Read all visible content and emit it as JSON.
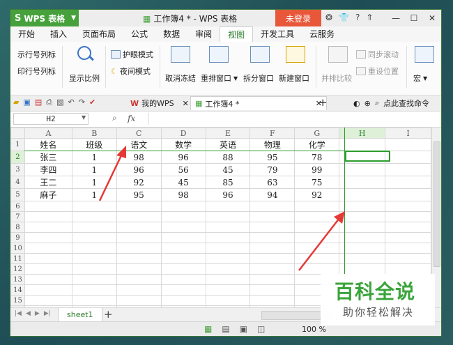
{
  "titlebar": {
    "app_name": "WPS 表格",
    "doc_title": "工作簿4 * - WPS 表格",
    "login_label": "未登录",
    "icons": [
      "skin-icon",
      "shirt-icon",
      "help-icon",
      "minimize-ribbon-icon"
    ]
  },
  "menu": {
    "items": [
      "开始",
      "插入",
      "页面布局",
      "公式",
      "数据",
      "审阅",
      "视图",
      "开发工具",
      "云服务"
    ],
    "active": "视图"
  },
  "ribbon": {
    "show_rowcol": "示行号列标",
    "print_rowcol": "印行号列标",
    "zoom_label": "显示比例",
    "eye_mode": "护眼模式",
    "night_mode": "夜间模式",
    "unfreeze": "取消冻结",
    "rearrange": "重排窗口",
    "split": "拆分窗口",
    "new_window": "新建窗口",
    "side_by_side": "并排比较",
    "sync_scroll": "同步滚动",
    "reset_pos": "重设位置",
    "macro": "宏"
  },
  "qbar": {
    "tab_mywps": "我的WPS",
    "tab_doc": "工作簿4 *",
    "search_label": "点此查找命令"
  },
  "formula": {
    "cell_ref": "H2",
    "fx": "fx",
    "value": ""
  },
  "grid": {
    "columns": [
      "A",
      "B",
      "C",
      "D",
      "E",
      "F",
      "G",
      "H",
      "I"
    ],
    "rows": [
      [
        "姓名",
        "班级",
        "语文",
        "数学",
        "英语",
        "物理",
        "化学",
        "",
        ""
      ],
      [
        "张三",
        "1",
        "98",
        "96",
        "88",
        "95",
        "78",
        "",
        ""
      ],
      [
        "李四",
        "1",
        "96",
        "56",
        "45",
        "79",
        "99",
        "",
        ""
      ],
      [
        "王二",
        "1",
        "92",
        "45",
        "85",
        "63",
        "75",
        "",
        ""
      ],
      [
        "麻子",
        "1",
        "95",
        "98",
        "96",
        "94",
        "92",
        "",
        ""
      ],
      [
        "",
        "",
        "",
        "",
        "",
        "",
        "",
        "",
        ""
      ],
      [
        "",
        "",
        "",
        "",
        "",
        "",
        "",
        "",
        ""
      ],
      [
        "",
        "",
        "",
        "",
        "",
        "",
        "",
        "",
        ""
      ],
      [
        "",
        "",
        "",
        "",
        "",
        "",
        "",
        "",
        ""
      ],
      [
        "",
        "",
        "",
        "",
        "",
        "",
        "",
        "",
        ""
      ],
      [
        "",
        "",
        "",
        "",
        "",
        "",
        "",
        "",
        ""
      ],
      [
        "",
        "",
        "",
        "",
        "",
        "",
        "",
        "",
        ""
      ],
      [
        "",
        "",
        "",
        "",
        "",
        "",
        "",
        "",
        ""
      ],
      [
        "",
        "",
        "",
        "",
        "",
        "",
        "",
        "",
        ""
      ],
      [
        "",
        "",
        "",
        "",
        "",
        "",
        "",
        "",
        ""
      ],
      [
        "",
        "",
        "",
        "",
        "",
        "",
        "",
        "",
        ""
      ]
    ]
  },
  "sheets": {
    "active": "sheet1"
  },
  "status": {
    "zoom": "100 %"
  },
  "watermark": {
    "line1": "百科全说",
    "line2": "助你轻松解决"
  },
  "colors": {
    "accent_green": "#46a13c",
    "login_red": "#e8573a",
    "arrow_red": "#e53935"
  }
}
